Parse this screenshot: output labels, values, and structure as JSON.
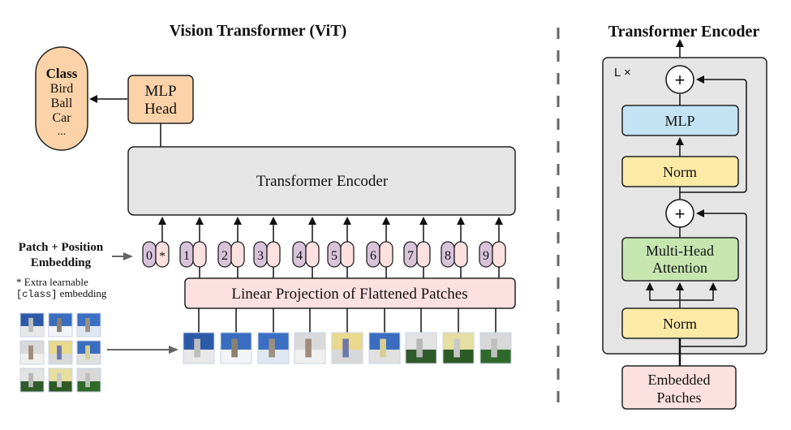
{
  "left_panel": {
    "title": "Vision Transformer (ViT)",
    "class_box": {
      "heading": "Class",
      "items": [
        "Bird",
        "Ball",
        "Car",
        "..."
      ]
    },
    "mlp_head": {
      "lines": [
        "MLP",
        "Head"
      ]
    },
    "encoder_label": "Transformer Encoder",
    "embedding_label": {
      "lines": [
        "Patch + Position",
        "Embedding"
      ]
    },
    "note": {
      "star_line": "* Extra learnable",
      "mono": "[class]",
      "rest": " embedding"
    },
    "position_tokens": [
      "0",
      "1",
      "2",
      "3",
      "4",
      "5",
      "6",
      "7",
      "8",
      "9"
    ],
    "class_token_mark": "*",
    "projection_label": "Linear Projection of Flattened Patches",
    "patch_count": 9,
    "grid_patches": [
      "dome-sky",
      "sky-tower",
      "sky-spire",
      "facade-windows",
      "facade-yellow",
      "tower-facade",
      "garden-left",
      "garden-mid",
      "garden-right"
    ]
  },
  "right_panel": {
    "title": "Transformer Encoder",
    "repeat_label": "L ×",
    "blocks": {
      "mlp": "MLP",
      "norm_top": "Norm",
      "attention": [
        "Multi-Head",
        "Attention"
      ],
      "norm_bottom": "Norm",
      "embedded": [
        "Embedded",
        "Patches"
      ]
    },
    "add_symbol": "+"
  },
  "colors": {
    "orange": "#fcd3a8",
    "encoder_gray": "#e5e5e5",
    "pink": "#fde0e0",
    "purple": "#d8c3d9",
    "blue": "#c3e3f5",
    "yellow": "#fdeaa6",
    "green": "#c6e6b0",
    "divider": "#666666"
  }
}
